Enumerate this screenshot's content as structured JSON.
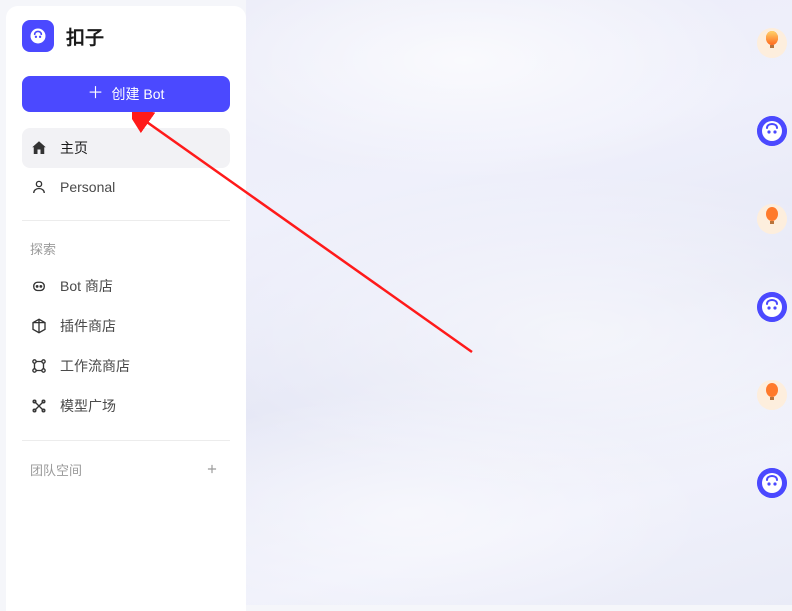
{
  "brand": {
    "name": "扣子"
  },
  "create_button": {
    "label": "创建 Bot"
  },
  "nav": {
    "primary": [
      {
        "label": "主页",
        "icon": "home-icon",
        "active": true
      },
      {
        "label": "Personal",
        "icon": "person-icon",
        "active": false
      }
    ]
  },
  "explore": {
    "section_label": "探索",
    "items": [
      {
        "label": "Bot 商店",
        "icon": "bot-store-icon"
      },
      {
        "label": "插件商店",
        "icon": "plugin-store-icon"
      },
      {
        "label": "工作流商店",
        "icon": "workflow-store-icon"
      },
      {
        "label": "模型广场",
        "icon": "model-plaza-icon"
      }
    ]
  },
  "team": {
    "label": "团队空间"
  },
  "right_avatars": [
    {
      "kind": "balloon"
    },
    {
      "kind": "bot"
    },
    {
      "kind": "balloon"
    },
    {
      "kind": "bot"
    },
    {
      "kind": "balloon"
    },
    {
      "kind": "bot"
    }
  ],
  "annotation": {
    "type": "arrow",
    "color": "#ff1a1a",
    "points_to": "create-bot-button"
  },
  "colors": {
    "primary": "#4b49ff",
    "text": "#1a1a1a",
    "muted": "#9a9a9a",
    "arrow": "#ff1a1a"
  }
}
